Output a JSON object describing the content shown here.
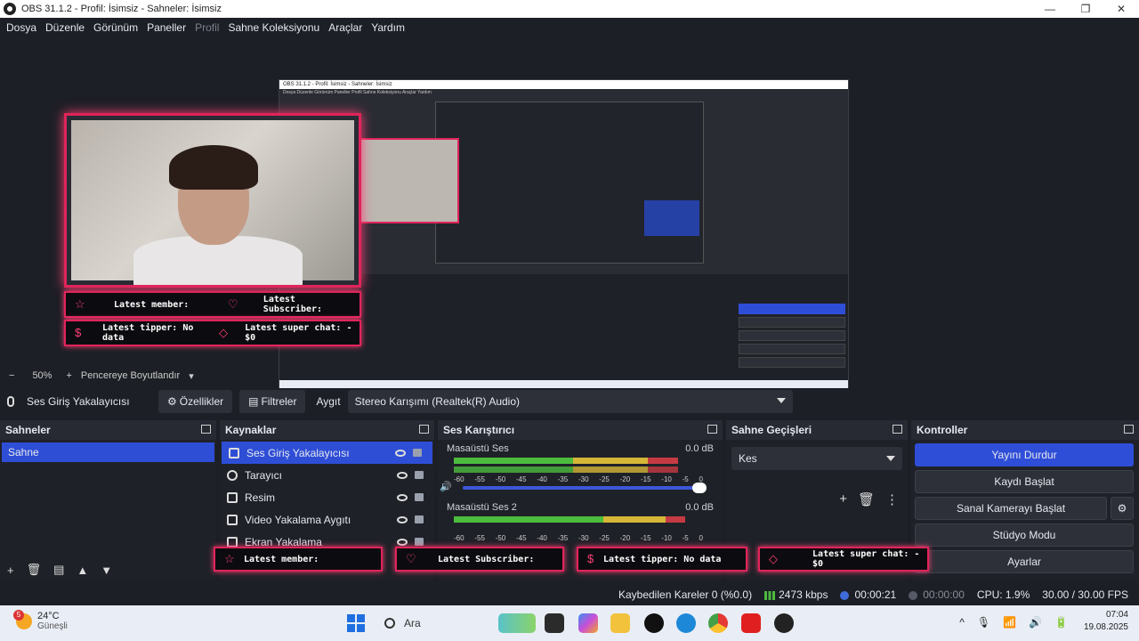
{
  "window": {
    "title": "OBS 31.1.2 - Profil: İsimsiz - Sahneler: İsimsiz",
    "minimize": "—",
    "maximize": "❐",
    "close": "✕"
  },
  "menu": [
    "Dosya",
    "Düzenle",
    "Görünüm",
    "Paneller",
    "Profil",
    "Sahne Koleksiyonu",
    "Araçlar",
    "Yardım"
  ],
  "preview": {
    "inner_title": "OBS 31.1.2 - Profil: İsimsiz - Sahneler: İsimsiz",
    "inner_menu": "Dosya  Düzenle  Görünüm  Paneller  Profil  Sahne Koleksiyonu  Araçlar  Yardım",
    "alerts": {
      "member": "Latest member:",
      "subscriber": "Latest Subscriber:",
      "tipper": "Latest tipper: No data",
      "superchat": "Latest super chat:  - $0"
    }
  },
  "zoom": {
    "minus": "−",
    "value": "50%",
    "plus": "+",
    "fit_label": "Pencereye Boyutlandır"
  },
  "source_toolbar": {
    "source_name": "Ses Giriş Yakalayıcısı",
    "properties": "Özellikler",
    "filters": "Filtreler",
    "device_label": "Aygıt",
    "device_value": "Stereo Karışımı (Realtek(R) Audio)"
  },
  "scenes": {
    "title": "Sahneler",
    "items": [
      "Sahne"
    ]
  },
  "sources": {
    "title": "Kaynaklar",
    "items": [
      "Ses Giriş Yakalayıcısı",
      "Tarayıcı",
      "Resim",
      "Video Yakalama Aygıtı",
      "Ekran Yakalama"
    ]
  },
  "mixer": {
    "title": "Ses Karıştırıcı",
    "channels": [
      {
        "name": "Masaüstü Ses",
        "db": "0.0 dB"
      },
      {
        "name": "Masaüstü Ses 2",
        "db": "0.0 dB"
      }
    ],
    "scale": [
      "-60",
      "-55",
      "-50",
      "-45",
      "-40",
      "-35",
      "-30",
      "-25",
      "-20",
      "-15",
      "-10",
      "-5",
      "0"
    ]
  },
  "transitions": {
    "title": "Sahne Geçişleri",
    "selected": "Kes"
  },
  "controls": {
    "title": "Kontroller",
    "stop_stream": "Yayını Durdur",
    "start_record": "Kaydı Başlat",
    "virtual_cam": "Sanal Kamerayı Başlat",
    "studio_mode": "Stüdyo Modu",
    "settings": "Ayarlar"
  },
  "status": {
    "dropped": "Kaybedilen Kareler 0 (%0.0)",
    "bitrate": "2473 kbps",
    "stream_time": "00:00:21",
    "record_time": "00:00:00",
    "cpu": "CPU: 1.9%",
    "fps": "30.00 / 30.00 FPS"
  },
  "taskbar": {
    "temp": "24°C",
    "weather": "Güneşli",
    "badge": "5",
    "search": "Ara",
    "time": "07:04",
    "date": "19.08.2025"
  },
  "colors": {
    "accent": "#2e4ed6",
    "alert_border": "#e0245b",
    "meter_green": "#4cbc3e",
    "meter_yellow": "#d6b637",
    "meter_red": "#c63b43"
  }
}
